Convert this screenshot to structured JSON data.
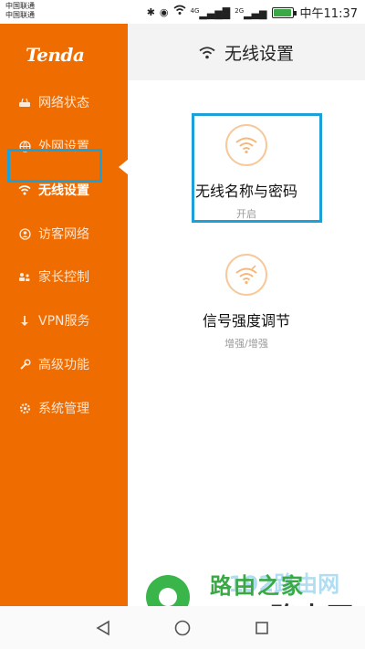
{
  "status_bar": {
    "carrier_1": "中国联通",
    "carrier_2": "中国联通",
    "signal_1": "4G",
    "signal_2": "2G",
    "time": "中午11:37"
  },
  "sidebar": {
    "logo": "Tenda",
    "items": [
      {
        "label": "网络状态",
        "icon": "router-icon"
      },
      {
        "label": "外网设置",
        "icon": "globe-icon"
      },
      {
        "label": "无线设置",
        "icon": "wifi-icon",
        "active": true
      },
      {
        "label": "访客网络",
        "icon": "guest-icon"
      },
      {
        "label": "家长控制",
        "icon": "parent-icon"
      },
      {
        "label": "VPN服务",
        "icon": "vpn-icon"
      },
      {
        "label": "高级功能",
        "icon": "wrench-icon"
      },
      {
        "label": "系统管理",
        "icon": "settings-icon"
      }
    ]
  },
  "header": {
    "title": "无线设置"
  },
  "cards": [
    {
      "title": "无线名称与密码",
      "sub": "开启"
    },
    {
      "title": "信号强度调节",
      "sub": "增强/增强"
    }
  ],
  "watermark": {
    "line1": "路由之家",
    "line2": "192路由网",
    "line3": "191路由网"
  },
  "colors": {
    "sidebar": "#ef6c00",
    "highlight": "#1d9fd8",
    "header_bg": "#f3f3f3"
  }
}
